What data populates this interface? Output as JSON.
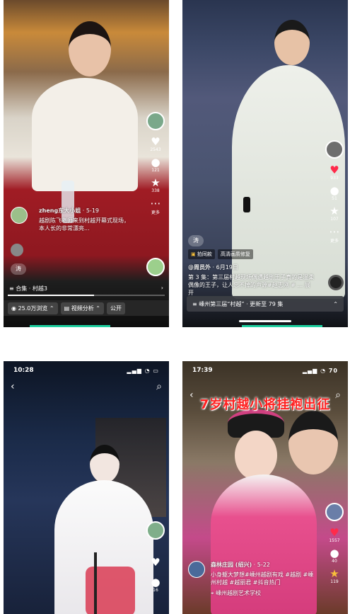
{
  "tile1": {
    "rail": {
      "likes": "2543",
      "comments": "121",
      "favorites": "338",
      "more": "更多"
    },
    "author": "zheng东大小姐",
    "date": "· 5-19",
    "caption": "越剧陈飞老师来到村越开幕式现场，本人长的非常漂亮...",
    "tag": "涛",
    "collection": "合集 · 村越3",
    "views": "25.0万浏览",
    "analysis": "视频分析",
    "public": "公开",
    "progress": 0.55
  },
  "tile2": {
    "rail": {
      "likes": "933",
      "comments": "51",
      "favorites": "107",
      "more": "更多"
    },
    "badge_left": "拍同款",
    "badge_right": "高清画质修复",
    "author": "@周员外",
    "date": "· 6月19日",
    "caption": "第 3 集：第三届村越现场偶遇越剧王子真的是温柔偶像的王子，让人忘不掉的声源#赵志刚 # ... 展开",
    "tag": "涛",
    "collection": "嵊州第三届“村越” · 更新至 79 集"
  },
  "tile3": {
    "time": "10:28",
    "signal": "▂▄▆ ◔ ▭",
    "rail": {
      "comments": "16"
    }
  },
  "tile4": {
    "time": "17:39",
    "signal": "▂▄▆ ◔ 70",
    "banner": "7岁村越小将挂袍出征",
    "rail": {
      "likes": "1557",
      "comments": "40",
      "favorites": "119"
    },
    "author": "森林庄园 (绍兴)",
    "date": "· 5-22",
    "caption": "小身躯大梦想#嵊州越剧有戏 #越剧 #嵊州村越 #越丽君 #抖音热门",
    "location": "嵊州越剧艺术学校"
  }
}
